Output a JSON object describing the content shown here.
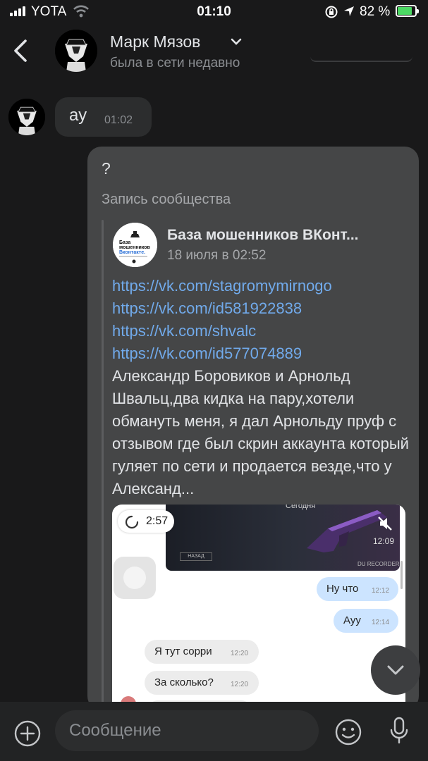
{
  "status_bar": {
    "carrier": "YOTA",
    "time": "01:10",
    "battery_percent": "82 %",
    "battery_level": 0.82
  },
  "header": {
    "name": "Марк Мязов",
    "status": "была в сети недавно"
  },
  "messages": {
    "incoming": {
      "text": "ау",
      "time": "01:02"
    },
    "outgoing": {
      "text": "?",
      "repost_label": "Запись сообщества",
      "community_name": "База мошенников ВКонт...",
      "community_date": "18 июля в 02:52",
      "links": [
        "https://vk.com/stagromymirnogo",
        "https://vk.com/id581922838",
        "https://vk.com/shvalc https://vk.com/id577074889"
      ],
      "body": "Александр Боровиков и Арнольд Швальц,два кидка на пару,хотели обмануть меня, я дал Арнольду пруф с отзывом где был скрин аккаунта который гуляет по сети и продается везде,что у Александ...",
      "video": {
        "duration": "2:57",
        "inner_time": "12:09",
        "inner_today": "Сегодня",
        "inner_back": "НАЗАД",
        "inner_recorder": "DU RECORDER",
        "chat": [
          {
            "text": "Ну что",
            "time": "12:12",
            "dir": "out"
          },
          {
            "text": "Ауу",
            "time": "12:14",
            "dir": "out"
          },
          {
            "text": "Я тут сорри",
            "time": "12:20",
            "dir": "in"
          },
          {
            "text": "За сколько?",
            "time": "12:20",
            "dir": "in"
          }
        ]
      }
    }
  },
  "composer": {
    "placeholder": "Сообщение"
  },
  "icons": {
    "back": "chevron-left-icon",
    "plus": "plus-icon",
    "emoji": "emoji-icon",
    "mic": "microphone-icon",
    "scroll_down": "chevron-down-icon"
  },
  "colors": {
    "background": "#19191a",
    "bubble_in": "#2c2d2e",
    "bubble_out": "#454647",
    "link": "#71aaeb",
    "battery_fill": "#4cd964"
  }
}
